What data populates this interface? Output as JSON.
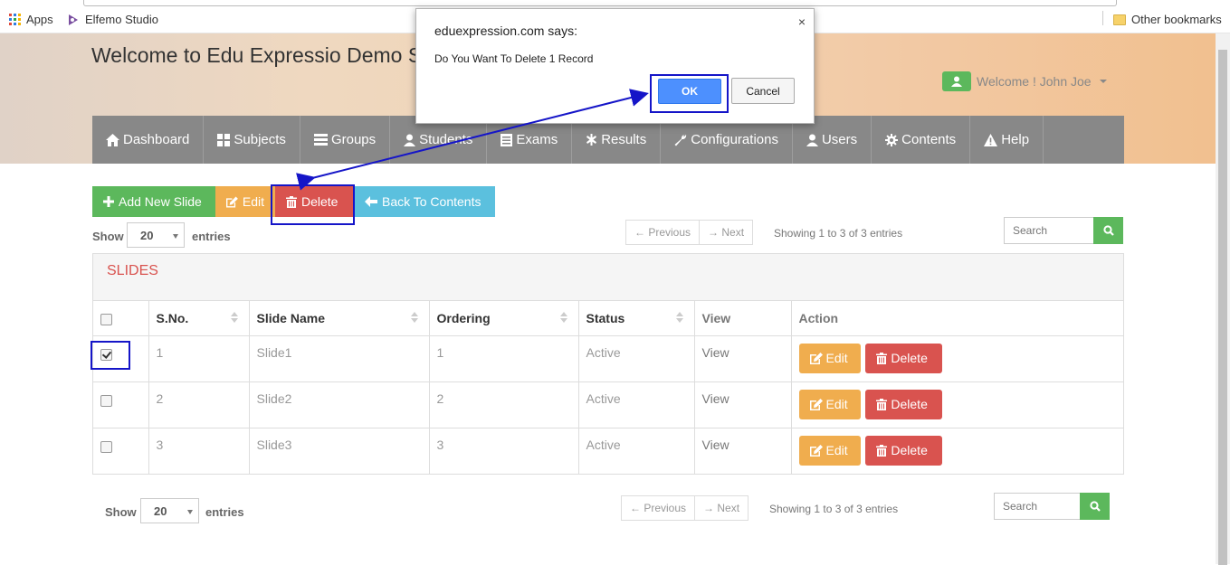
{
  "bookmarks": {
    "apps_label": "Apps",
    "studio_label": "Elfemo Studio",
    "other_label": "Other bookmarks"
  },
  "header": {
    "title": "Welcome to Edu Expressio Demo S",
    "user_label": "Welcome ! John Joe"
  },
  "nav": {
    "items": [
      {
        "label": "Dashboard",
        "icon": "home-icon"
      },
      {
        "label": "Subjects",
        "icon": "grid-icon"
      },
      {
        "label": "Groups",
        "icon": "server-icon"
      },
      {
        "label": "Students",
        "icon": "user-icon"
      },
      {
        "label": "Exams",
        "icon": "list-icon"
      },
      {
        "label": "Results",
        "icon": "asterisk-icon"
      },
      {
        "label": "Configurations",
        "icon": "wrench-icon"
      },
      {
        "label": "Users",
        "icon": "user-icon"
      },
      {
        "label": "Contents",
        "icon": "gear-icon"
      },
      {
        "label": "Help",
        "icon": "warning-icon"
      }
    ]
  },
  "toolbar": {
    "add_label": "Add New Slide",
    "edit_label": "Edit",
    "delete_label": "Delete",
    "back_label": "Back To Contents"
  },
  "controls_top": {
    "show_label": "Show",
    "entries_value": "20",
    "entries_label": "entries",
    "previous_label": "← Previous",
    "next_label": "→ Next",
    "showing_text": "Showing 1 to 3 of 3 entries",
    "search_placeholder": "Search"
  },
  "controls_bottom": {
    "show_label": "Show",
    "entries_value": "20",
    "entries_label": "entries",
    "previous_label": "← Previous",
    "next_label": "→ Next",
    "showing_text": "Showing 1 to 3 of 3 entries",
    "search_placeholder": "Search"
  },
  "panel": {
    "title": "SLIDES",
    "columns": [
      "S.No.",
      "Slide Name",
      "Ordering",
      "Status",
      "View",
      "Action"
    ],
    "rows": [
      {
        "checked": true,
        "sno": "1",
        "name": "Slide1",
        "ordering": "1",
        "status": "Active",
        "view": "View",
        "edit": "Edit",
        "delete": "Delete"
      },
      {
        "checked": false,
        "sno": "2",
        "name": "Slide2",
        "ordering": "2",
        "status": "Active",
        "view": "View",
        "edit": "Edit",
        "delete": "Delete"
      },
      {
        "checked": false,
        "sno": "3",
        "name": "Slide3",
        "ordering": "3",
        "status": "Active",
        "view": "View",
        "edit": "Edit",
        "delete": "Delete"
      }
    ]
  },
  "dialog": {
    "title": "eduexpression.com says:",
    "message": "Do You Want To Delete 1 Record",
    "ok_label": "OK",
    "cancel_label": "Cancel",
    "close_symbol": "×"
  },
  "colors": {
    "success": "#5cb85c",
    "warning": "#f0ad4e",
    "danger": "#d9534f",
    "info": "#5bc0de",
    "nav": "#888888",
    "highlight": "#1515c8"
  }
}
